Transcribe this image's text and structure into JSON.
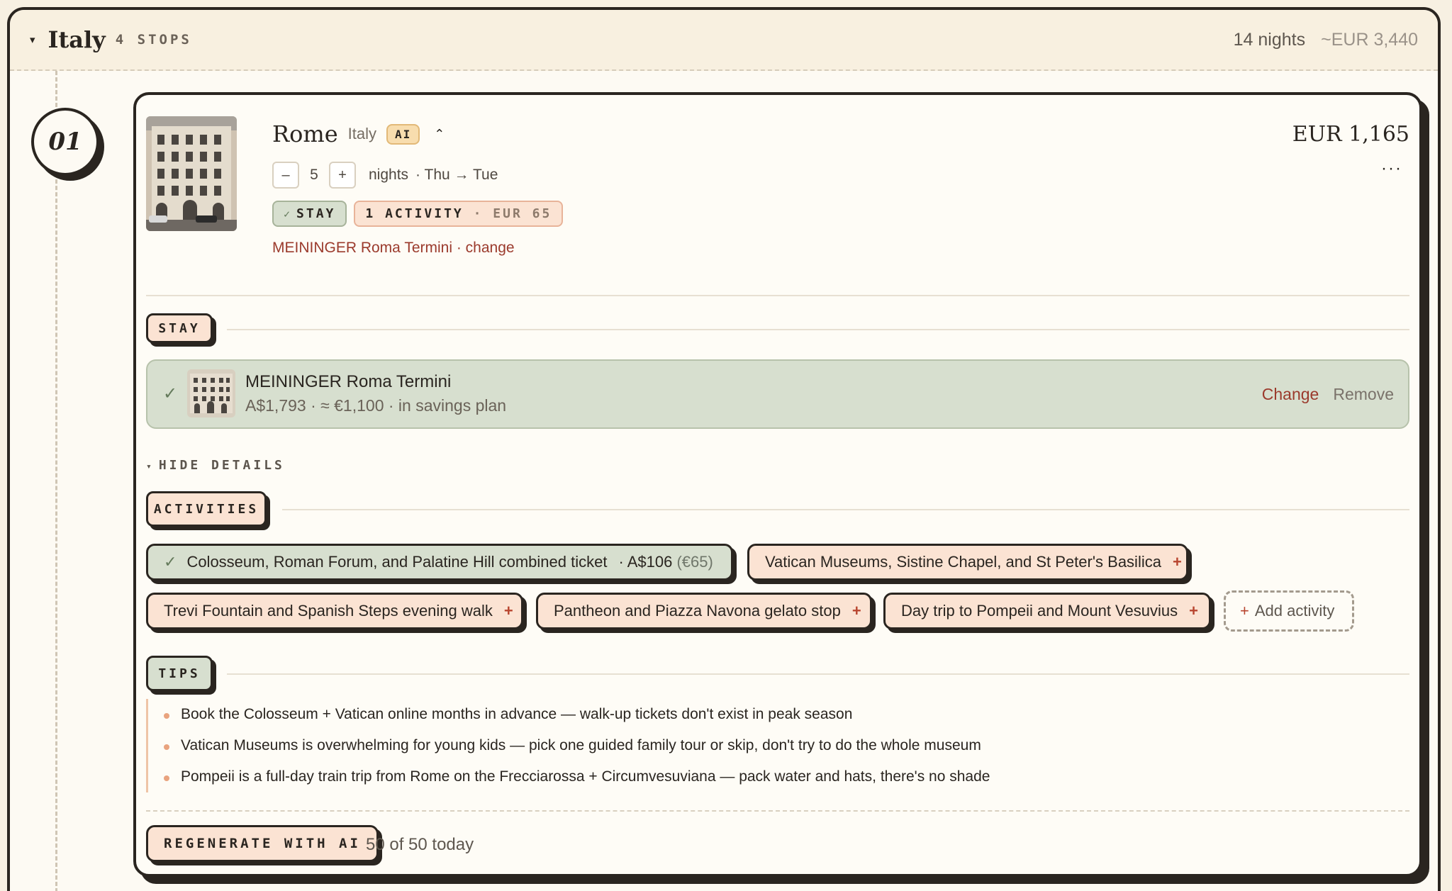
{
  "country": {
    "name": "Italy",
    "stops": "4 STOPS",
    "nights": "14 nights",
    "cost": "~EUR 3,440"
  },
  "stop": {
    "number": "01",
    "city": "Rome",
    "country": "Italy",
    "ai_tag": "AI",
    "nights_value": "5",
    "nights_label": "nights",
    "days": "· Thu → Tue",
    "minus_label": "–",
    "plus_label": "+",
    "stay_tag": "STAY",
    "stay_check": "✓",
    "activity_tag": "1 ACTIVITY",
    "activity_tag_cost": "· EUR 65",
    "hotel_link": "MEININGER Roma Termini · change",
    "price": "EUR 1,165",
    "more": "···"
  },
  "sections": {
    "stay": "STAY",
    "activities": "ACTIVITIES",
    "tips": "TIPS",
    "hide_details": "HIDE DETAILS",
    "hide_caret": "▾"
  },
  "stay_item": {
    "name": "MEININGER Roma Termini",
    "sub": "A$1,793 · ≈ €1,100 · in savings plan",
    "change": "Change",
    "remove": "Remove"
  },
  "activities": [
    {
      "label": "Colosseum, Roman Forum, and Palatine Hill combined ticket",
      "price": "·   A$106",
      "price_eur": "(€65)"
    },
    {
      "label": "Vatican Museums, Sistine Chapel, and St Peter's Basilica"
    },
    {
      "label": "Trevi Fountain and Spanish Steps evening walk"
    },
    {
      "label": "Pantheon and Piazza Navona gelato stop"
    },
    {
      "label": "Day trip to Pompeii and Mount Vesuvius"
    }
  ],
  "add_activity": "Add activity",
  "tips": [
    "Book the Colosseum + Vatican online months in advance — walk-up tickets don't exist in peak season",
    "Vatican Museums is overwhelming for young kids — pick one guided family tour or skip, don't try to do the whole museum",
    "Pompeii is a full-day train trip from Rome on the Frecciarossa + Circumvesuviana — pack water and hats, there's no shade"
  ],
  "regenerate": {
    "label": "REGENERATE WITH AI",
    "count": "50 of 50 today"
  },
  "colors": {
    "ink": "#2a2520",
    "peach": "#fbe3d3",
    "sage": "#d7dfcf",
    "accent_red": "#9b3a2c",
    "cream": "#fdfaf3"
  }
}
